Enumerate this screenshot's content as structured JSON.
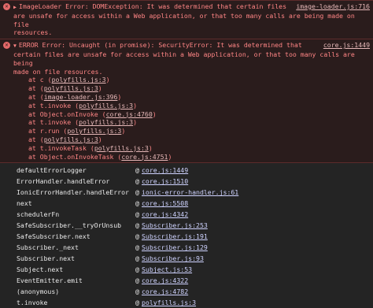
{
  "error1": {
    "line1": "ImageLoader Error:  DOMException: It was determined that certain files",
    "line2": "are unsafe for access within a Web application, or that too many calls are being made on file",
    "line3": "resources.",
    "source": "image-loader.js:716"
  },
  "error2": {
    "line1": "ERROR Error: Uncaught (in promise): SecurityError: It was determined that",
    "line2": "certain files are unsafe for access within a Web application, or that too many calls are being",
    "line3": "made on file resources.",
    "source": "core.js:1449",
    "stack": [
      {
        "fn": "at c",
        "loc": "polyfills.js:3"
      },
      {
        "fn": "at",
        "loc": "polyfills.js:3"
      },
      {
        "fn": "at",
        "loc": "image-loader.js:396"
      },
      {
        "fn": "at t.invoke",
        "loc": "polyfills.js:3"
      },
      {
        "fn": "at Object.onInvoke",
        "loc": "core.js:4760"
      },
      {
        "fn": "at t.invoke",
        "loc": "polyfills.js:3"
      },
      {
        "fn": "at r.run",
        "loc": "polyfills.js:3"
      },
      {
        "fn": "at",
        "loc": "polyfills.js:3"
      },
      {
        "fn": "at t.invokeTask",
        "loc": "polyfills.js:3"
      },
      {
        "fn": "at Object.onInvokeTask",
        "loc": "core.js:4751"
      }
    ]
  },
  "trace": [
    {
      "fn": "defaultErrorLogger",
      "loc": "core.js:1449"
    },
    {
      "fn": "ErrorHandler.handleError",
      "loc": "core.js:1510"
    },
    {
      "fn": "IonicErrorHandler.handleError",
      "loc": "ionic-error-handler.js:61"
    },
    {
      "fn": "next",
      "loc": "core.js:5508"
    },
    {
      "fn": "schedulerFn",
      "loc": "core.js:4342"
    },
    {
      "fn": "SafeSubscriber.__tryOrUnsub",
      "loc": "Subscriber.js:253"
    },
    {
      "fn": "SafeSubscriber.next",
      "loc": "Subscriber.js:191"
    },
    {
      "fn": "Subscriber._next",
      "loc": "Subscriber.js:129"
    },
    {
      "fn": "Subscriber.next",
      "loc": "Subscriber.js:93"
    },
    {
      "fn": "Subject.next",
      "loc": "Subject.js:53"
    },
    {
      "fn": "EventEmitter.emit",
      "loc": "core.js:4322"
    },
    {
      "fn": "(anonymous)",
      "loc": "core.js:4782"
    },
    {
      "fn": "t.invoke",
      "loc": "polyfills.js:3"
    }
  ],
  "at_symbol": "@"
}
